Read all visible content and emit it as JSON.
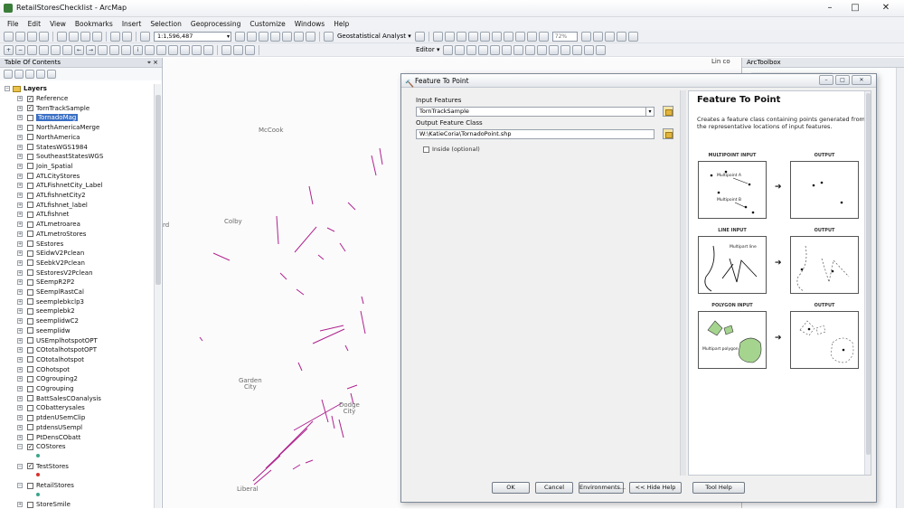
{
  "window": {
    "title": "RetailStoresChecklist - ArcMap",
    "minimize": "–",
    "maximize": "□",
    "close": "✕"
  },
  "menubar": [
    "File",
    "Edit",
    "View",
    "Bookmarks",
    "Insert",
    "Selection",
    "Geoprocessing",
    "Customize",
    "Windows",
    "Help"
  ],
  "toolbar": {
    "scale": "1:1,596,487",
    "geostat": "Geostatistical Analyst ▾",
    "editor": "Editor ▾",
    "zoom_pct": "72%"
  },
  "toc": {
    "title": "Table Of Contents",
    "pins": "⌖ ×",
    "root": "Layers",
    "layers": [
      {
        "name": "Reference",
        "checked": true,
        "expanded": false,
        "selected": false
      },
      {
        "name": "TornTrackSample",
        "checked": true,
        "expanded": false,
        "selected": false
      },
      {
        "name": "TornadoMag",
        "checked": false,
        "expanded": false,
        "selected": true
      },
      {
        "name": "NorthAmericaMerge",
        "checked": false,
        "expanded": false,
        "selected": false
      },
      {
        "name": "NorthAmerica",
        "checked": false,
        "expanded": false,
        "selected": false
      },
      {
        "name": "StatesWGS1984",
        "checked": false,
        "expanded": false,
        "selected": false
      },
      {
        "name": "SoutheastStatesWGS",
        "checked": false,
        "expanded": false,
        "selected": false
      },
      {
        "name": "Join_Spatial",
        "checked": false,
        "expanded": false,
        "selected": false
      },
      {
        "name": "ATLCityStores",
        "checked": false,
        "expanded": false,
        "selected": false
      },
      {
        "name": "ATLFishnetCity_Label",
        "checked": false,
        "expanded": false,
        "selected": false
      },
      {
        "name": "ATLfishnetCity2",
        "checked": false,
        "expanded": false,
        "selected": false
      },
      {
        "name": "ATLfishnet_label",
        "checked": false,
        "expanded": false,
        "selected": false
      },
      {
        "name": "ATLfishnet",
        "checked": false,
        "expanded": false,
        "selected": false
      },
      {
        "name": "ATLmetroarea",
        "checked": false,
        "expanded": false,
        "selected": false
      },
      {
        "name": "ATLmetroStores",
        "checked": false,
        "expanded": false,
        "selected": false
      },
      {
        "name": "SEstores",
        "checked": false,
        "expanded": false,
        "selected": false
      },
      {
        "name": "SEidwV2Pclean",
        "checked": false,
        "expanded": false,
        "selected": false
      },
      {
        "name": "SEebkV2Pclean",
        "checked": false,
        "expanded": false,
        "selected": false
      },
      {
        "name": "SEstoresV2Pclean",
        "checked": false,
        "expanded": false,
        "selected": false
      },
      {
        "name": "SEempR2P2",
        "checked": false,
        "expanded": false,
        "selected": false
      },
      {
        "name": "SEemplRastCal",
        "checked": false,
        "expanded": false,
        "selected": false
      },
      {
        "name": "seemplebkclp3",
        "checked": false,
        "expanded": false,
        "selected": false
      },
      {
        "name": "seemplebk2",
        "checked": false,
        "expanded": false,
        "selected": false
      },
      {
        "name": "seemplidwC2",
        "checked": false,
        "expanded": false,
        "selected": false
      },
      {
        "name": "seemplidw",
        "checked": false,
        "expanded": false,
        "selected": false
      },
      {
        "name": "USEmplhotspotOPT",
        "checked": false,
        "expanded": false,
        "selected": false
      },
      {
        "name": "COtotalhotspotOPT",
        "checked": false,
        "expanded": false,
        "selected": false
      },
      {
        "name": "COtotalhotspot",
        "checked": false,
        "expanded": false,
        "selected": false
      },
      {
        "name": "COhotspot",
        "checked": false,
        "expanded": false,
        "selected": false
      },
      {
        "name": "COgrouping2",
        "checked": false,
        "expanded": false,
        "selected": false
      },
      {
        "name": "COgrouping",
        "checked": false,
        "expanded": false,
        "selected": false
      },
      {
        "name": "BattSalesCOanalysis",
        "checked": false,
        "expanded": false,
        "selected": false
      },
      {
        "name": "CObatterysales",
        "checked": false,
        "expanded": false,
        "selected": false
      },
      {
        "name": "ptdenUSemClip",
        "checked": false,
        "expanded": false,
        "selected": false
      },
      {
        "name": "ptdensUSempl",
        "checked": false,
        "expanded": false,
        "selected": false
      },
      {
        "name": "PtDensCObatt",
        "checked": false,
        "expanded": false,
        "selected": false
      },
      {
        "name": "COStores",
        "checked": true,
        "expanded": true,
        "selected": false
      },
      {
        "name": "TestStores",
        "checked": true,
        "expanded": true,
        "selected": false
      },
      {
        "name": "RetailStores",
        "checked": false,
        "expanded": true,
        "selected": false
      },
      {
        "name": "StoreSmile",
        "checked": false,
        "expanded": false,
        "selected": false
      }
    ]
  },
  "map": {
    "hint": "Lin co",
    "cities": [
      {
        "name": "McCook"
      },
      {
        "name": "Colby"
      },
      {
        "name": "rd"
      },
      {
        "name": "Garden\nCity"
      },
      {
        "name": "Dodge\nCity"
      },
      {
        "name": "Liberal"
      }
    ]
  },
  "dialog": {
    "title": "Feature To Point",
    "input_label": "Input Features",
    "input_value": "TornTrackSample",
    "output_label": "Output Feature Class",
    "output_value": "W:\\KatieCoria\\TornadoPoint.shp",
    "inside_label": "Inside (optional)",
    "help": {
      "title": "Feature To Point",
      "description": "Creates a feature class containing points generated from the representative locations of input features.",
      "multipoint_input": "MULTIPOINT INPUT",
      "line_input": "LINE INPUT",
      "polygon_input": "POLYGON INPUT",
      "output": "OUTPUT",
      "multipoint_a": "Multipoint A",
      "multipoint_b": "Multipoint B",
      "multipart_line": "Multipart line",
      "multipart_polygon": "Multipart polygon"
    },
    "buttons": {
      "ok": "OK",
      "cancel": "Cancel",
      "environments": "Environments...",
      "hide_help": "<< Hide Help",
      "tool_help": "Tool Help"
    }
  },
  "arctoolbox": {
    "title": "ArcToolbox",
    "dock_tab": "Lin co"
  },
  "colors": {
    "track": "#b0238f",
    "selection": "#3a6fc4",
    "polygon_fill": "#a5d48f"
  }
}
